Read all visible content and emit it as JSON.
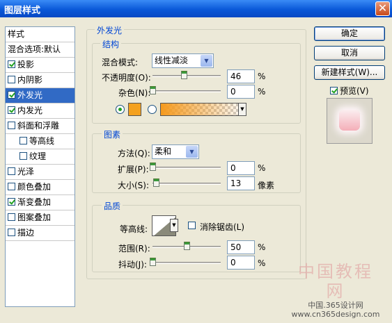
{
  "window": {
    "title": "图层样式",
    "close_glyph": "✕"
  },
  "style_list": {
    "header": "样式",
    "blend_options": "混合选项:默认",
    "items": [
      {
        "label": "投影",
        "checked": true
      },
      {
        "label": "内阴影",
        "checked": false
      },
      {
        "label": "外发光",
        "checked": true,
        "selected": true
      },
      {
        "label": "内发光",
        "checked": true
      },
      {
        "label": "斜面和浮雕",
        "checked": false
      },
      {
        "label": "等高线",
        "checked": false,
        "indent": true
      },
      {
        "label": "纹理",
        "checked": false,
        "indent": true
      },
      {
        "label": "光泽",
        "checked": false
      },
      {
        "label": "颜色叠加",
        "checked": false
      },
      {
        "label": "渐变叠加",
        "checked": true
      },
      {
        "label": "图案叠加",
        "checked": false
      },
      {
        "label": "描边",
        "checked": false
      }
    ]
  },
  "outer_glow": {
    "title": "外发光",
    "structure": {
      "title": "结构",
      "blend_mode_label": "混合模式:",
      "blend_mode_value": "线性减淡",
      "opacity_label": "不透明度(O):",
      "opacity_value": "46",
      "opacity_unit": "%",
      "noise_label": "杂色(N):",
      "noise_value": "0",
      "noise_unit": "%",
      "color": "#f4a11f"
    },
    "elements": {
      "title": "图素",
      "method_label": "方法(Q):",
      "method_value": "柔和",
      "spread_label": "扩展(P):",
      "spread_value": "0",
      "spread_unit": "%",
      "size_label": "大小(S):",
      "size_value": "13",
      "size_unit": "像素"
    },
    "quality": {
      "title": "品质",
      "contour_label": "等高线:",
      "anti_alias_label": "消除锯齿(L)",
      "anti_alias_checked": false,
      "range_label": "范围(R):",
      "range_value": "50",
      "range_unit": "%",
      "jitter_label": "抖动(J):",
      "jitter_value": "0",
      "jitter_unit": "%"
    }
  },
  "buttons": {
    "ok": "确定",
    "cancel": "取消",
    "new_style": "新建样式(W)...",
    "preview_label": "预览(V)",
    "preview_checked": true
  },
  "watermark": {
    "big": "中国教程网",
    "line1": "中国.365设计网",
    "line2": "www.cn365design.com"
  }
}
